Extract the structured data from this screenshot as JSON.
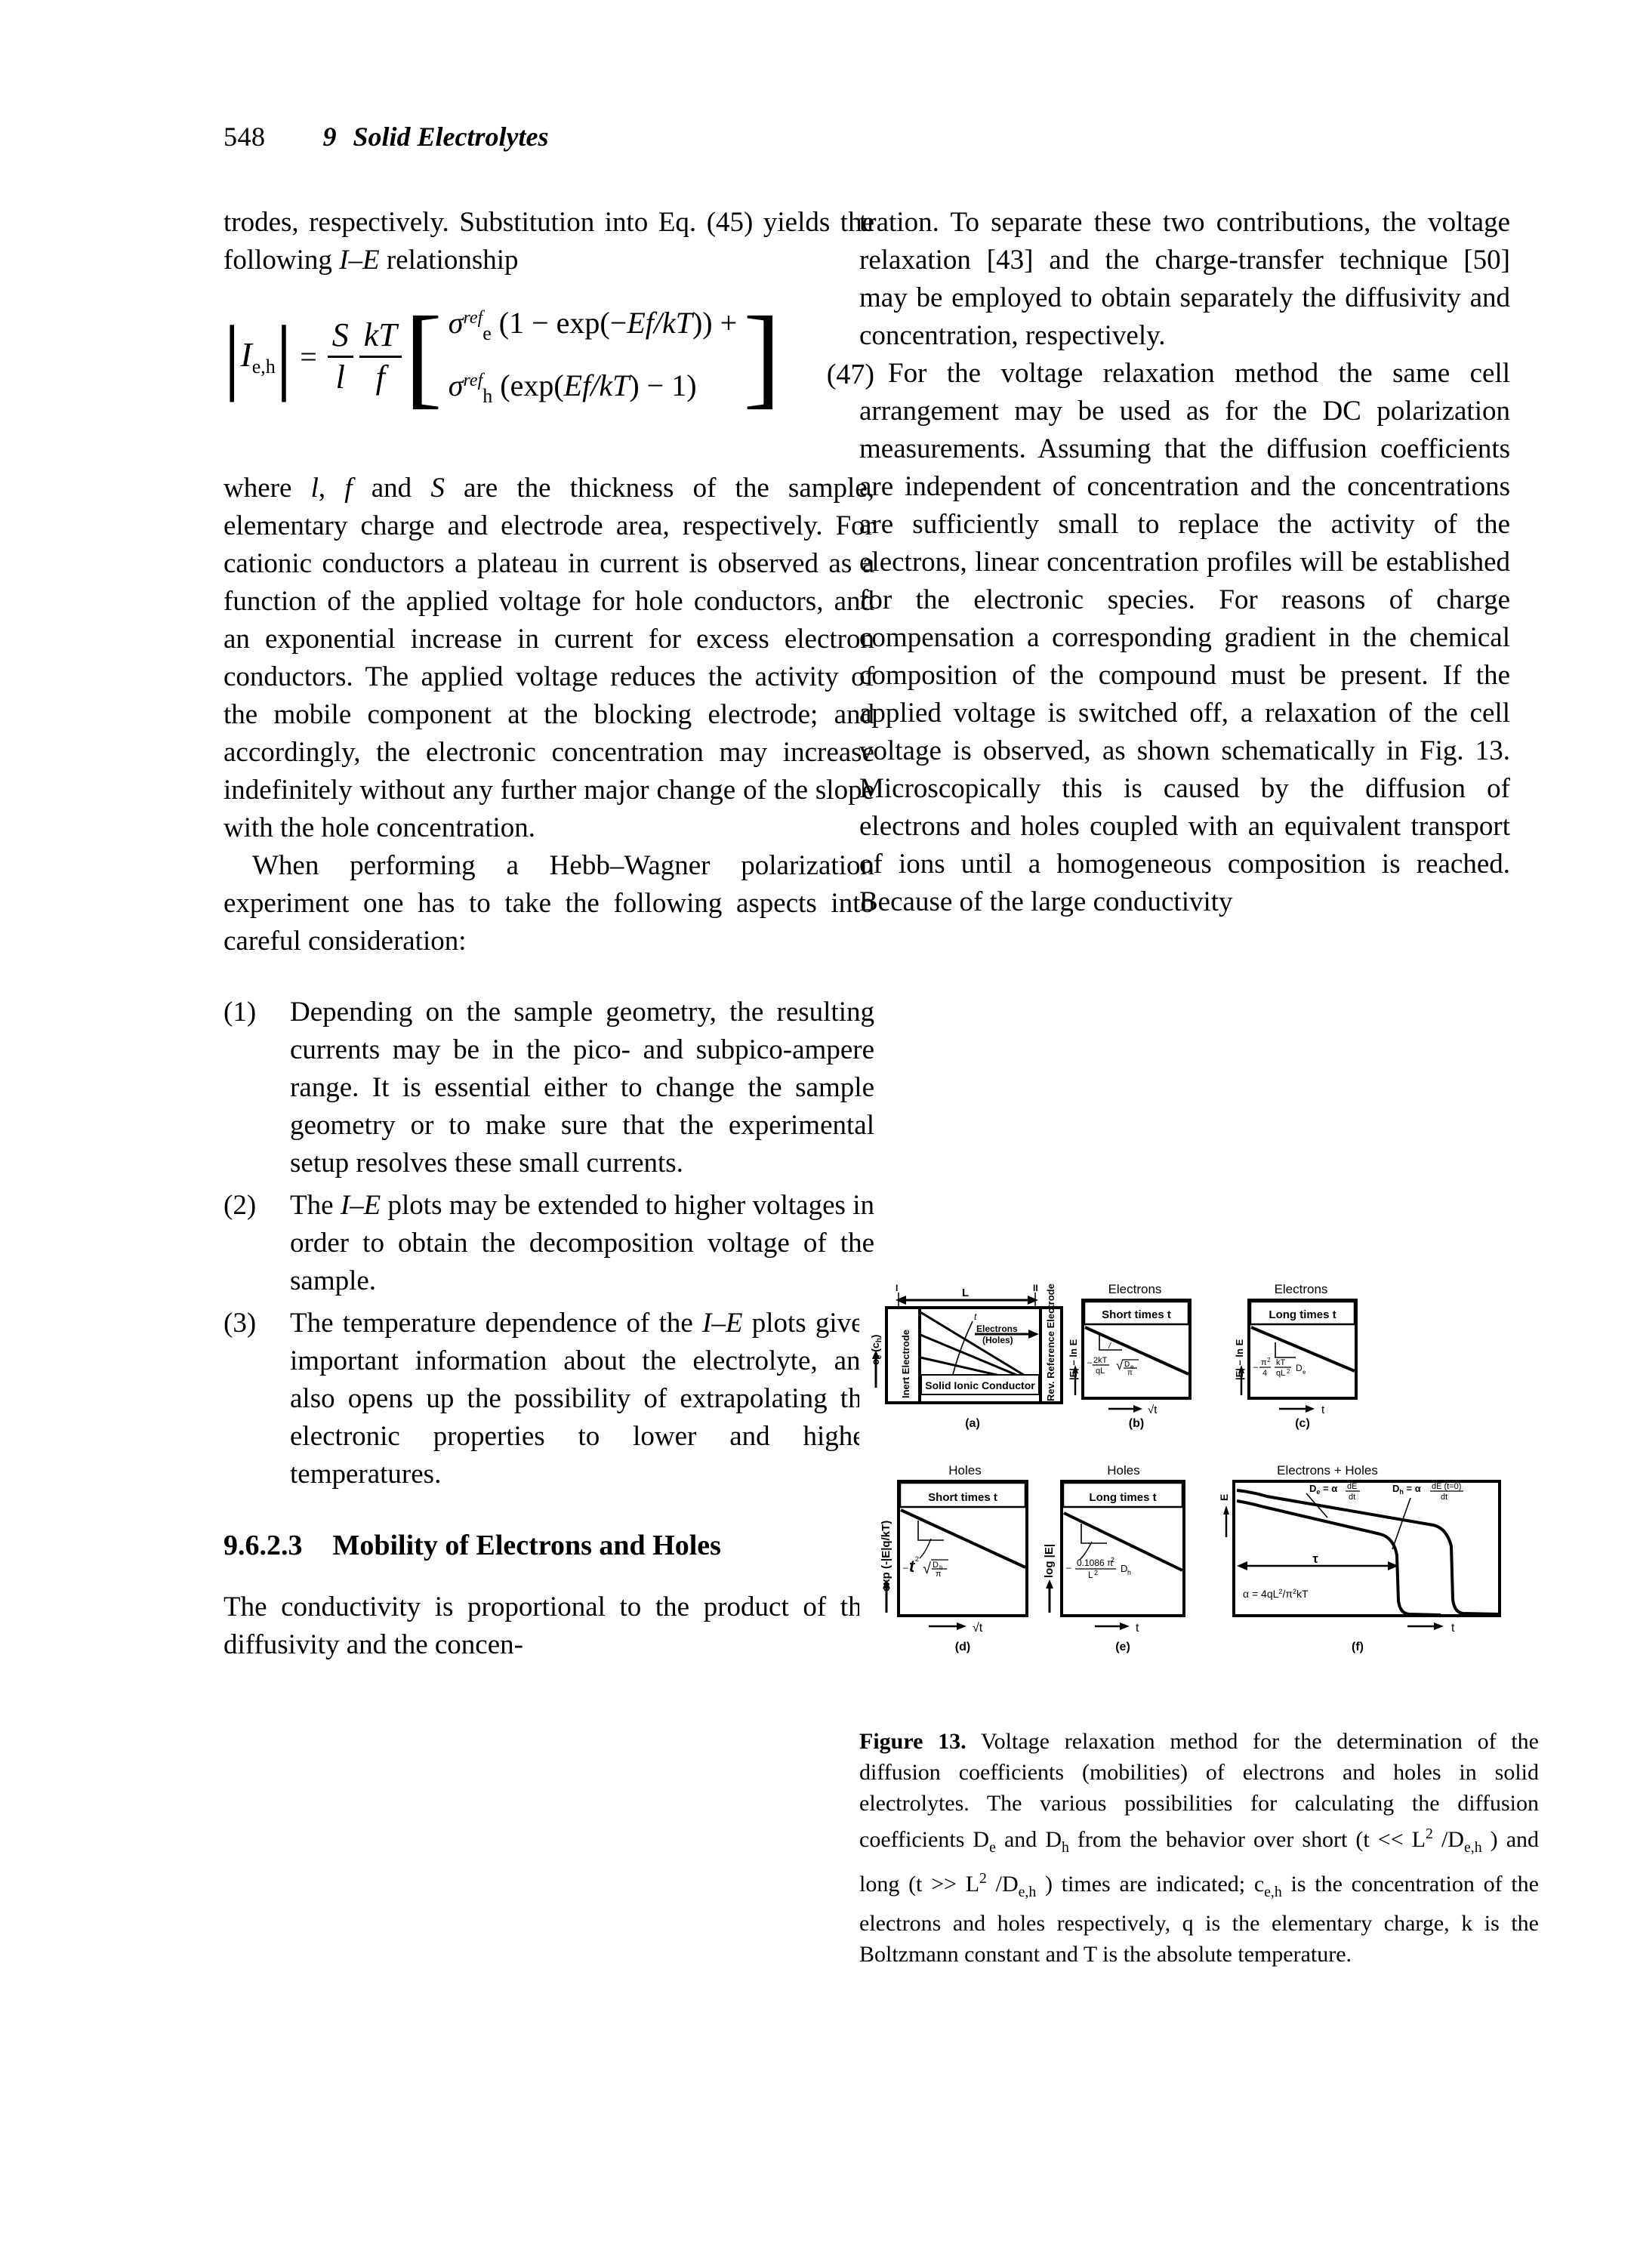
{
  "running_head": {
    "folio": "548",
    "chapter_number": "9",
    "chapter_title": "Solid Electrolytes"
  },
  "left_column": {
    "para1": "trodes, respectively. Substitution into Eq. (45) yields the following I–E relationship",
    "equation": {
      "number": "(47)",
      "lhs": "|I",
      "lhs_sub": "e,h",
      "lhs_close": "| =",
      "frac1_num": "S",
      "frac1_den": "l",
      "frac2_num": "kT",
      "frac2_den": "f",
      "row1": "σ_e^ref (1 – exp(–Ef/kT)) +",
      "row2": "σ_h^ref (exp(Ef/kT) – 1)",
      "sigma": "σ",
      "ref": "ref",
      "sub_e": "e",
      "sub_h": "h",
      "row1_tail": "(1 – exp(–Ef/kT)) +",
      "row2_tail": "(exp(Ef/kT) – 1)"
    },
    "para2": "where l, f and S are the thickness of the sample, elementary charge and electrode area, respectively. For cationic conductors a plateau in current is observed as a function of the applied voltage for hole conductors, and an exponential increase in current for excess electron conductors. The applied voltage reduces the activity of the mobile component at the blocking electrode; and accordingly, the electronic concentration may increase indefinitely without any further major change of the slope with the hole concentration.",
    "para3": "When performing a Hebb–Wagner polarization experiment one has to take the following aspects into careful consideration:",
    "list": [
      {
        "marker": "(1)",
        "text": "Depending on the sample geometry, the resulting currents may be in the pico- and subpico-ampere range. It is essential either to change the sample geometry or to make sure that the experimental setup resolves these small currents."
      },
      {
        "marker": "(2)",
        "text": "The I–E plots may be extended to higher voltages in order to obtain the decomposition voltage of the sample."
      },
      {
        "marker": "(3)",
        "text": "The temperature dependence of the I–E plots gives important information about the electrolyte, and also opens up the possibility of extrapolating the electronic properties to lower and higher temperatures."
      }
    ],
    "section_heading": {
      "number": "9.6.2.3",
      "title": "Mobility of Electrons and Holes"
    },
    "para4": "The conductivity is proportional to the product of the diffusivity and the concen-"
  },
  "right_column": {
    "para1": "tration. To separate these two contributions, the voltage relaxation [43] and the charge-transfer technique [50] may be employed to obtain separately the diffusivity and concentration, respectively.",
    "para2": "For the voltage relaxation method the same cell arrangement may be used as for the DC polarization measurements. Assuming that the diffusion coefficients are independent of concentration and the concentrations are sufficiently small to replace the activity of the electrons, linear concentration profiles will be established for the electronic species. For reasons of charge compensation a corresponding gradient in the chemical composition of the compound must be present. If the applied voltage is switched off, a relaxation of the cell voltage is observed, as shown schematically in Fig. 13. Microscopically this is caused by the diffusion of electrons and holes coupled with an equivalent transport of ions until a homogeneous composition is reached. Because of the large conductivity"
  },
  "figure": {
    "label": "Figure 13.",
    "caption_text": " Voltage relaxation method for the determination of the diffusion coefficients (mobilities) of electrons and holes in solid electrolytes. The various possibilities for calculating the diffusion coefficients D",
    "caption_part2": " and D",
    "caption_part3": " from the behavior over short (t << L",
    "caption_part4": " /D",
    "caption_part5": " ) and long (t >> L",
    "caption_part6": " /D",
    "caption_part7": " ) times are indicated; c",
    "caption_part8": " is the concentration of the electrons and holes respectively, q is the elementary charge, k is the Boltzmann constant and T is the absolute temperature.",
    "sub_e": "e",
    "sub_h": "h",
    "sub_eh": "e,h",
    "sup_2": "2",
    "panels": [
      {
        "id": "(a)",
        "axis_y": "c",
        "axis_y_sub": "e",
        "axis_y_paren": "(c",
        "axis_y_paren_sub": "h",
        "axis_y_close": ")",
        "mark_left": "I",
        "mark_right": "II",
        "length_label": "L",
        "electrode_left": "Inert Electrode",
        "material": "Solid Ionic Conductor",
        "electrode_right": "Rev. Reference Electrode",
        "flow_label_1": "Electrons",
        "flow_label_2": "(Holes)",
        "time_arrow": "t"
      },
      {
        "id": "(b)",
        "title": "Electrons",
        "box": "Short times t",
        "ylabel": "|E| – ln E",
        "xlabel": "√t",
        "slope": "– 2kT/qL √(De/π)"
      },
      {
        "id": "(c)",
        "title": "Electrons",
        "box": "Long times t",
        "ylabel": "|E| – ln E",
        "xlabel": "t",
        "slope": "– π²/4 · kT/qL² · De"
      },
      {
        "id": "(d)",
        "title": "Holes",
        "box": "Short times t",
        "ylabel": "exp (-|E|q/kT)",
        "xlabel": "√t",
        "slope": "– 2 √(Dh/π)"
      },
      {
        "id": "(e)",
        "title": "Holes",
        "box": "Long times t",
        "ylabel": "log |E|",
        "xlabel": "t",
        "slope": "– 0.1086 π²/L² Dh"
      },
      {
        "id": "(f)",
        "title": "Electrons + Holes",
        "ylabel": "E",
        "xlabel": "t",
        "ann_de": "De = α dE/dt",
        "ann_dh": "Dh = α dE (t=0)/dt",
        "ann_tau": "τ",
        "ann_alpha": "α = 4qL²/π²kT"
      }
    ]
  }
}
